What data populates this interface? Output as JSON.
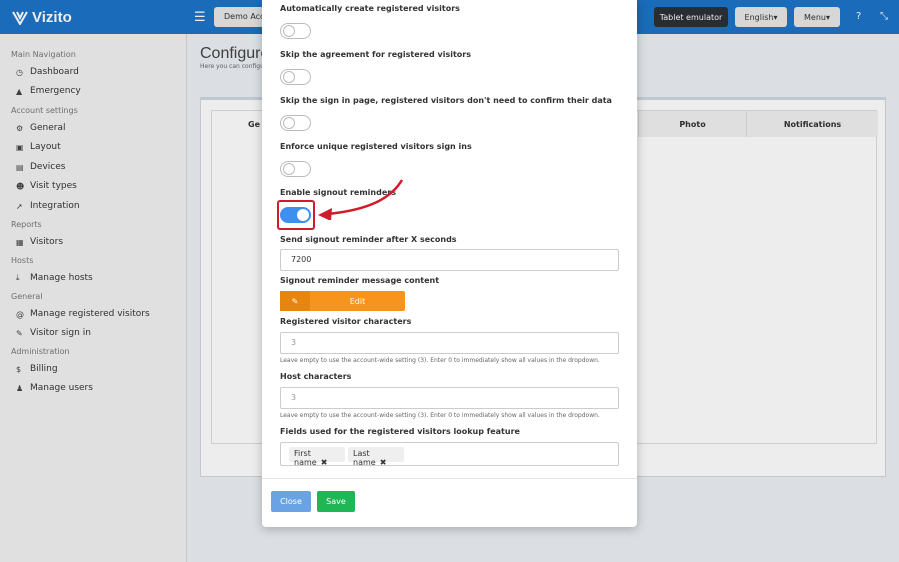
{
  "app": {
    "name": "Vizito"
  },
  "header": {
    "account_label": "Demo Account",
    "tablet_emulator": "Tablet emulator",
    "language": "English",
    "menu": "Menu",
    "icons": [
      "hamburger-icon",
      "help-icon",
      "fullscreen-icon"
    ]
  },
  "sidebar": {
    "sections": [
      {
        "heading": "Main Navigation",
        "items": [
          {
            "label": "Dashboard",
            "icon": "dashboard-icon"
          },
          {
            "label": "Emergency",
            "icon": "warning-icon"
          }
        ]
      },
      {
        "heading": "Account settings",
        "items": [
          {
            "label": "General",
            "icon": "cog-icon"
          },
          {
            "label": "Layout",
            "icon": "image-icon"
          },
          {
            "label": "Devices",
            "icon": "monitor-icon"
          },
          {
            "label": "Visit types",
            "icon": "users-icon"
          },
          {
            "label": "Integration",
            "icon": "plug-icon"
          }
        ]
      },
      {
        "heading": "Reports",
        "items": [
          {
            "label": "Visitors",
            "icon": "list-icon"
          }
        ]
      },
      {
        "heading": "Hosts",
        "items": [
          {
            "label": "Manage hosts",
            "icon": "download-icon"
          }
        ]
      },
      {
        "heading": "General",
        "items": [
          {
            "label": "Manage registered visitors",
            "icon": "at-icon"
          },
          {
            "label": "Visitor sign in",
            "icon": "pencil-icon"
          }
        ]
      },
      {
        "heading": "Administration",
        "items": [
          {
            "label": "Billing",
            "icon": "dollar-icon"
          },
          {
            "label": "Manage users",
            "icon": "user-plus-icon"
          }
        ]
      }
    ]
  },
  "page": {
    "title": "Configure",
    "subtitle": "Here you can configu",
    "table_headers": {
      "ge": "Ge",
      "photo": "Photo",
      "notifications": "Notifications"
    }
  },
  "modal": {
    "settings": [
      {
        "label": "Automatically create registered visitors",
        "enabled": false
      },
      {
        "label": "Skip the agreement for registered visitors",
        "enabled": false
      },
      {
        "label": "Skip the sign in page, registered visitors don't need to confirm their data",
        "enabled": false
      },
      {
        "label": "Enforce unique registered visitors sign ins",
        "enabled": false
      },
      {
        "label": "Enable signout reminders",
        "enabled": true
      }
    ],
    "reminder_seconds": {
      "label": "Send signout reminder after X seconds",
      "value": "7200"
    },
    "reminder_message": {
      "label": "Signout reminder message content",
      "button": "Edit"
    },
    "visitor_chars": {
      "label": "Registered visitor characters",
      "placeholder": "3",
      "hint": "Leave empty to use the account-wide setting (3). Enter 0 to immediately show all values in the dropdown."
    },
    "host_chars": {
      "label": "Host characters",
      "placeholder": "3",
      "hint": "Leave empty to use the account-wide setting (3). Enter 0 to immediately show all values in the dropdown."
    },
    "lookup_fields": {
      "label": "Fields used for the registered visitors lookup feature",
      "tags": [
        "First name",
        "Last name"
      ]
    },
    "close": "Close",
    "save": "Save"
  },
  "annotation": {
    "color": "#d21b2a"
  }
}
